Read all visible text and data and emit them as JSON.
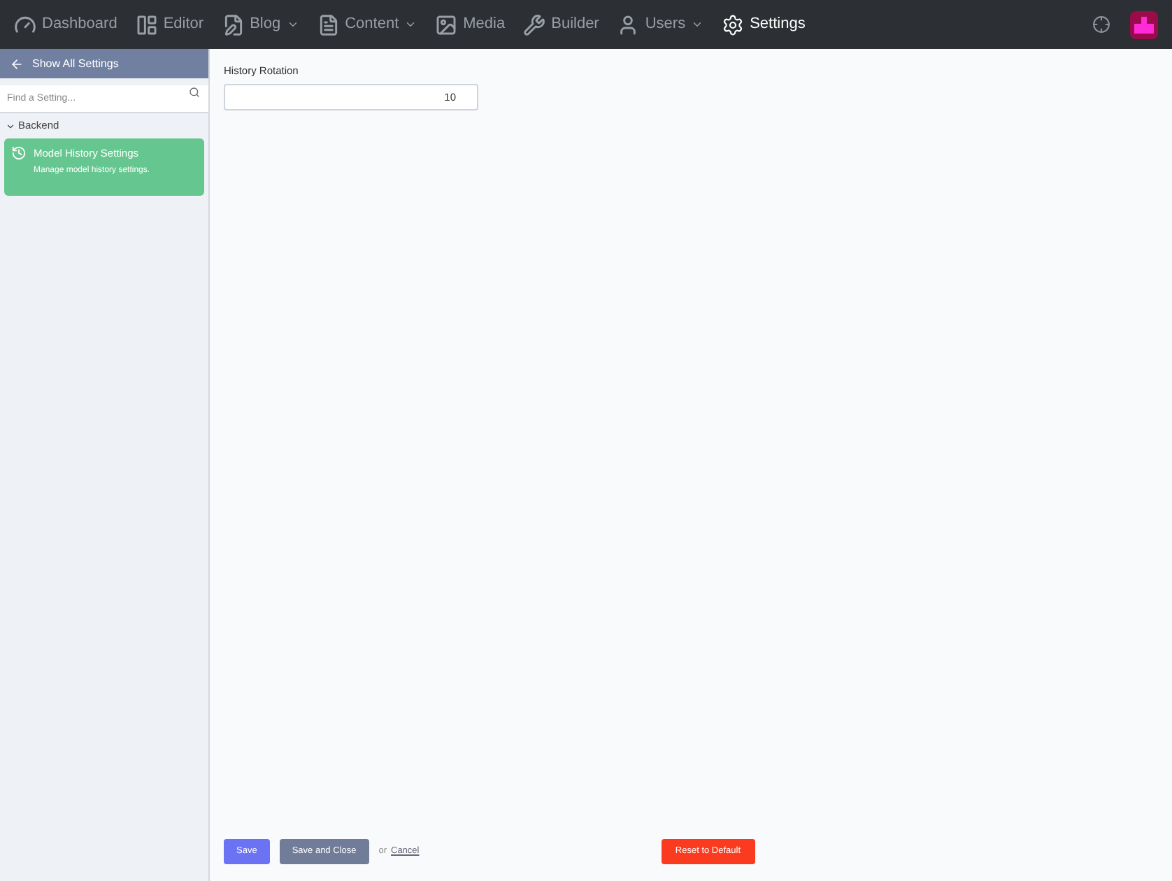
{
  "nav": {
    "items": [
      {
        "label": "Dashboard",
        "kind": "gauge",
        "dropdown": false,
        "selected": false
      },
      {
        "label": "Editor",
        "kind": "editor",
        "dropdown": false,
        "selected": false
      },
      {
        "label": "Blog",
        "kind": "pen",
        "dropdown": true,
        "selected": false
      },
      {
        "label": "Content",
        "kind": "doc",
        "dropdown": true,
        "selected": false
      },
      {
        "label": "Media",
        "kind": "image",
        "dropdown": false,
        "selected": false
      },
      {
        "label": "Builder",
        "kind": "wrench",
        "dropdown": false,
        "selected": false
      },
      {
        "label": "Users",
        "kind": "user",
        "dropdown": true,
        "selected": false
      },
      {
        "label": "Settings",
        "kind": "gear",
        "dropdown": false,
        "selected": true
      }
    ]
  },
  "sidebar": {
    "back_label": "Show All Settings",
    "search": {
      "placeholder": "Find a Setting..."
    },
    "groups": [
      {
        "label": "Backend",
        "expanded": true,
        "items": [
          {
            "title": "Model History Settings",
            "description": "Manage model history settings.",
            "selected": true
          }
        ]
      }
    ]
  },
  "form": {
    "fields": [
      {
        "label": "History Rotation",
        "value": "10"
      }
    ]
  },
  "actions": {
    "save": "Save",
    "save_close": "Save and Close",
    "or": "or",
    "cancel": "Cancel",
    "reset": "Reset to Default"
  }
}
